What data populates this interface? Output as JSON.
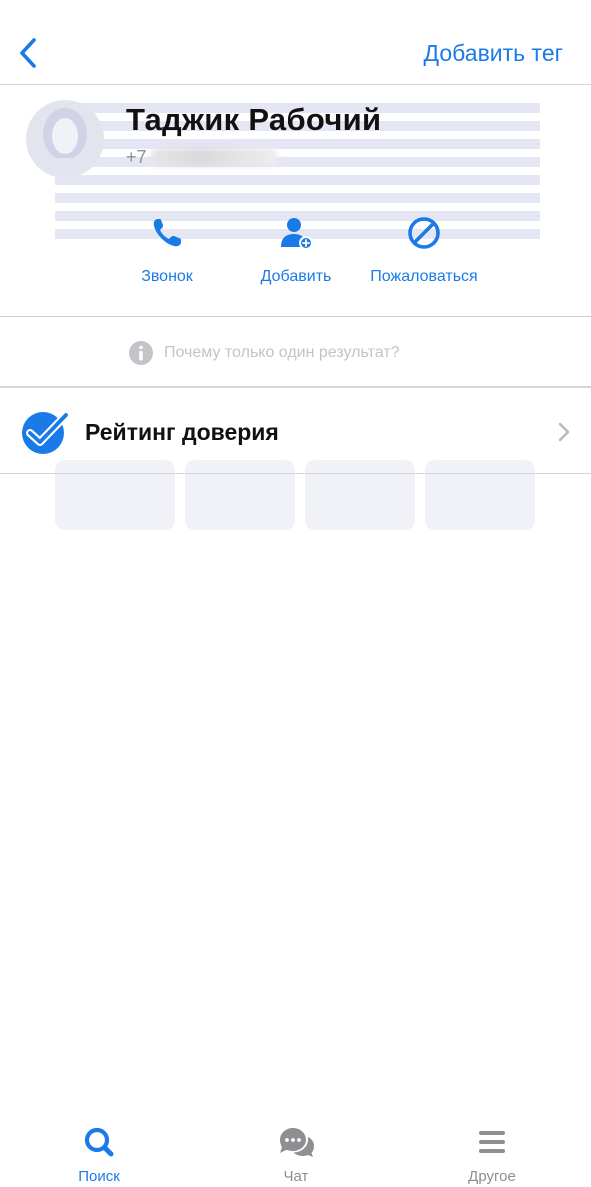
{
  "navbar": {
    "back_icon": "chevron-left-icon",
    "add_tag_label": "Добавить тег"
  },
  "contact": {
    "name": "Таджик Рабочий",
    "phone_prefix": "+7",
    "avatar_icon": "user-silhouette-icon"
  },
  "actions": [
    {
      "label": "Звонок",
      "icon": "phone-icon"
    },
    {
      "label": "Добавить",
      "icon": "add-user-icon"
    },
    {
      "label": "Пожаловаться",
      "icon": "block-icon"
    }
  ],
  "info": {
    "text": "Почему только один результат?",
    "icon": "info-icon"
  },
  "trust": {
    "label": "Рейтинг доверия",
    "icon": "verified-check-icon",
    "chevron_icon": "chevron-right-icon"
  },
  "tabbar": {
    "tabs": [
      {
        "label": "Поиск",
        "icon": "search-icon",
        "active": true
      },
      {
        "label": "Чат",
        "icon": "chat-icon",
        "active": false
      },
      {
        "label": "Другое",
        "icon": "menu-icon",
        "active": false
      }
    ]
  },
  "colors": {
    "accent": "#1a7be8",
    "inactive": "#8e8e93",
    "divider": "#d3d3d8",
    "watermark": "#dfe2f0"
  }
}
